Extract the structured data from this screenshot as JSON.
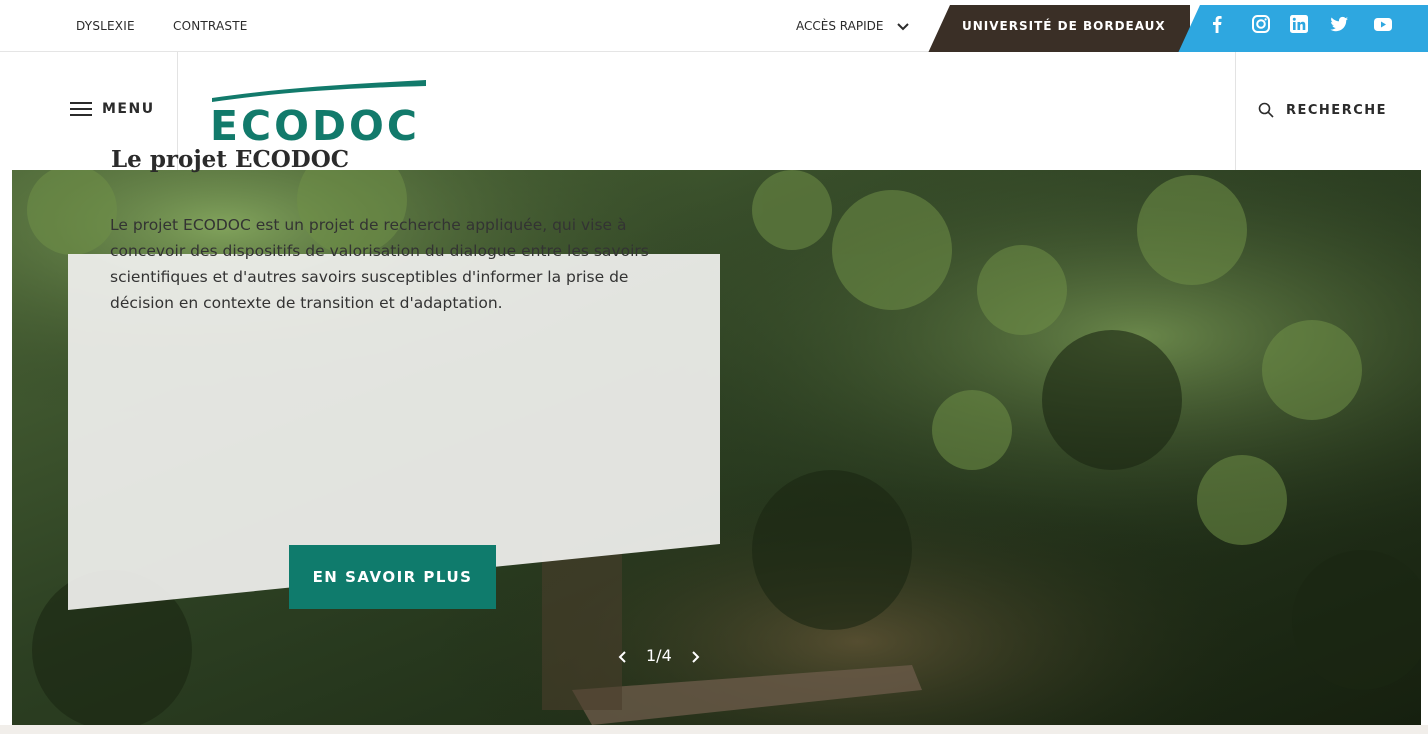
{
  "topbar": {
    "dyslexia": "DYSLEXIE",
    "contrast": "CONTRASTE",
    "quick_access": "ACCÈS RAPIDE",
    "university": "UNIVERSITÉ DE BORDEAUX",
    "social": [
      "facebook-icon",
      "instagram-icon",
      "linkedin-icon",
      "twitter-icon",
      "youtube-icon"
    ]
  },
  "header": {
    "menu_label": "MENU",
    "logo_text": "ECODOC",
    "search_label": "RECHERCHE"
  },
  "hero": {
    "title": "Le projet ECODOC",
    "text": "Le projet ECODOC est un projet de recherche appliquée, qui vise à concevoir des dispositifs de valorisation du dialogue entre les savoirs scientifiques et d'autres savoirs susceptibles d'informer la prise de décision en contexte de transition et d'adaptation.",
    "cta": "EN SAVOIR PLUS",
    "pager": "1/4"
  },
  "colors": {
    "brand_green": "#0f7b6c",
    "university_band": "#3a2f26",
    "social_band": "#2ea7e0"
  }
}
